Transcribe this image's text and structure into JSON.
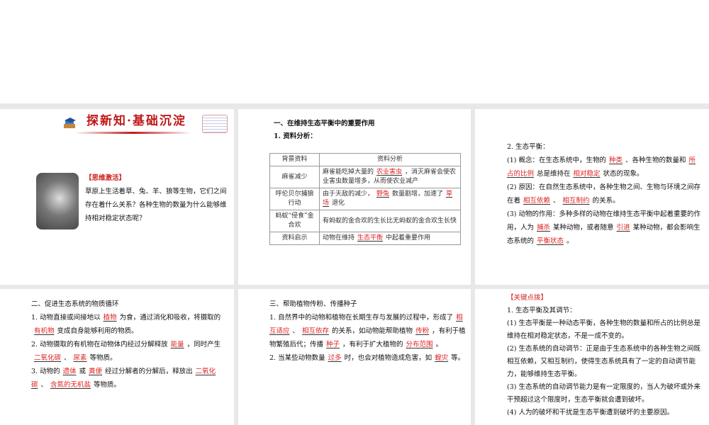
{
  "slide1": {
    "title": "探新知·基础沉淀",
    "tag": "【思维激活】",
    "body": "草原上生活着草、兔、羊、狼等生物，它们之间存在着什么关系？各种生物的数量为什么能够维持相对稳定状态呢？"
  },
  "slide2": {
    "heading": "一、在维持生态平衡中的重要作用",
    "sub": "1. 资料分析：",
    "table": {
      "headers": [
        "背景资料",
        "资料分析"
      ],
      "rows": [
        {
          "bg": "麻雀减少",
          "a": "麻雀能吃掉大量的",
          "ans": "农业害虫",
          "b": "，消灭麻雀会使农业害虫数量增多，从而使农业减产"
        },
        {
          "bg": "呼伦贝尔捕狼行动",
          "a": "由于天敌的减少，",
          "ans": "野兔",
          "b": "数量剧增，加速了",
          "ans2": "草场",
          "c": "退化"
        },
        {
          "bg": "蚂蚁“侵食”金合欢",
          "a": "有蚂蚁的金合欢的生长比无蚂蚁的金合欢生长快"
        },
        {
          "bg": "资料启示",
          "a": "动物在维持",
          "ans": "生态平衡",
          "b": "中起着重要作用"
        }
      ]
    }
  },
  "slide3": {
    "heading": "2. 生态平衡：",
    "p1": [
      "(1) 概念：在生态系统中，生物的",
      "种类",
      "、各种生物的数量和",
      "所占的比例",
      "总是维持在",
      "相对稳定",
      "状态的现象。"
    ],
    "p2": [
      "(2) 原因：在自然生态系统中，各种生物之间、生物与环境之间存在着",
      "相互依赖",
      "、",
      "相互制约",
      "的关系。"
    ],
    "p3": [
      "(3) 动物的作用：多种多样的动物在维持生态平衡中起着重要的作用，人为",
      "捕杀",
      "某种动物，或者随意",
      "引进",
      "某种动物，都会影响生态系统的",
      "平衡状态",
      "。"
    ]
  },
  "slide4": {
    "heading": "二、促进生态系统的物质循环",
    "p1": [
      "1. 动物直接或间接地以",
      "植物",
      "为食，通过消化和吸收，将摄取的",
      "有机物",
      "变成自身能够利用的物质。"
    ],
    "p2": [
      "2. 动物摄取的有机物在动物体内经过分解释放",
      "能量",
      "，同时产生",
      "二氧化碳",
      "、",
      "尿素",
      "等物质。"
    ],
    "p3": [
      "3. 动物的",
      "遗体",
      "或",
      "粪便",
      "经过分解者的分解后，释放出",
      "二氧化碳",
      "、",
      "含氮的无机盐",
      "等物质。"
    ]
  },
  "slide5": {
    "heading": "三、帮助植物传粉、传播种子",
    "p1": [
      "1. 自然界中的动物和植物在长期生存与发展的过程中，形成了",
      "相互适应",
      "、",
      "相互依存",
      "的关系，如动物能帮助植物",
      "传粉",
      "，有利于植物繁殖后代；传播",
      "种子",
      "，有利于扩大植物的",
      "分布范围",
      "。"
    ],
    "p2": [
      "2. 当某些动物数量",
      "过多",
      "时，也会对植物造成危害，如",
      "蝗灾",
      "等。"
    ]
  },
  "slide6": {
    "tag": "【关键点拨】",
    "heading": "1. 生态平衡及其调节：",
    "items": [
      "(1) 生态平衡是一种动态平衡，各种生物的数量和所占的比例总是维持在相对稳定状态，不是一成不变的。",
      "(2) 生态系统的自动调节：正是由于生态系统中的各种生物之间既相互依赖，又相互制约，使得生态系统具有了一定的自动调节能力，能够维持生态平衡。",
      "(3) 生态系统的自动调节能力是有一定限度的，当人为破坏或外来干预超过这个限度时，生态平衡就会遭到破坏。",
      "(4) 人为的破坏和干扰是生态平衡遭到破坏的主要原因。"
    ]
  }
}
